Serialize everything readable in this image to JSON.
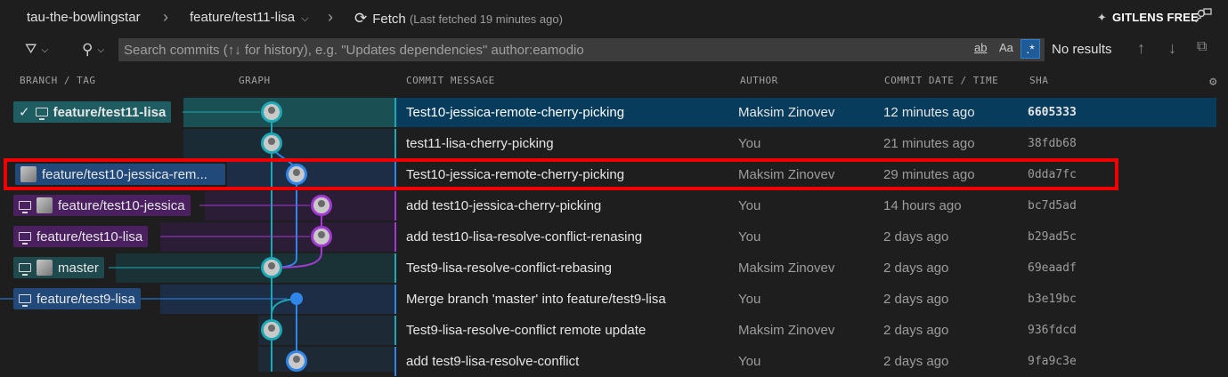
{
  "topbar": {
    "repo": "tau-the-bowlingstar",
    "branch": "feature/test11-lisa",
    "fetch_label": "Fetch",
    "fetch_status": "(Last fetched 19 minutes ago)",
    "gitlens_label": "GITLENS FREE"
  },
  "search": {
    "placeholder": "Search commits (↑↓ for history), e.g. \"Updates dependencies\" author:eamodio",
    "value": "",
    "match_word": "ab",
    "match_case": "Aa",
    "regex": ".*",
    "results": "No results"
  },
  "columns": {
    "branch": "BRANCH / TAG",
    "graph": "GRAPH",
    "message": "COMMIT MESSAGE",
    "author": "AUTHOR",
    "date": "COMMIT DATE / TIME",
    "sha": "SHA"
  },
  "colors": {
    "teal": "#1e5e63",
    "teal_line": "#1ca9b5",
    "blue": "#214a7a",
    "blue_line": "#2f86e8",
    "purple": "#4a2060",
    "purple_line": "#a23ad1",
    "selected": "#073c5d",
    "highlight": "#f00000"
  },
  "commits": [
    {
      "ref": "feature/test11-lisa",
      "message": "Test10-jessica-remote-cherry-picking",
      "author": "Maksim Zinovev",
      "date": "12 minutes ago",
      "sha": "6605333"
    },
    {
      "ref": "",
      "message": "test11-lisa-cherry-picking",
      "author": "You",
      "date": "21 minutes ago",
      "sha": "38fdb68"
    },
    {
      "ref": "feature/test10-jessica-rem...",
      "message": "Test10-jessica-remote-cherry-picking",
      "author": "Maksim Zinovev",
      "date": "29 minutes ago",
      "sha": "0dda7fc"
    },
    {
      "ref": "feature/test10-jessica",
      "message": "add test10-jessica-cherry-picking",
      "author": "You",
      "date": "14 hours ago",
      "sha": "bc7d5ad"
    },
    {
      "ref": "feature/test10-lisa",
      "message": "add test10-lisa-resolve-conflict-renasing",
      "author": "You",
      "date": "2 days ago",
      "sha": "b29ad5c"
    },
    {
      "ref": "master",
      "message": "Test9-lisa-resolve-conflict-rebasing",
      "author": "Maksim Zinovev",
      "date": "2 days ago",
      "sha": "69eaadf"
    },
    {
      "ref": "feature/test9-lisa",
      "message": "Merge branch 'master' into feature/test9-lisa",
      "author": "You",
      "date": "2 days ago",
      "sha": "b3e19bc"
    },
    {
      "ref": "",
      "message": "Test9-lisa-resolve-conflict remote update",
      "author": "Maksim Zinovev",
      "date": "2 days ago",
      "sha": "936fdcd"
    },
    {
      "ref": "",
      "message": "add test9-lisa-resolve-conflict",
      "author": "You",
      "date": "2 days ago",
      "sha": "9fa9c3e"
    }
  ]
}
